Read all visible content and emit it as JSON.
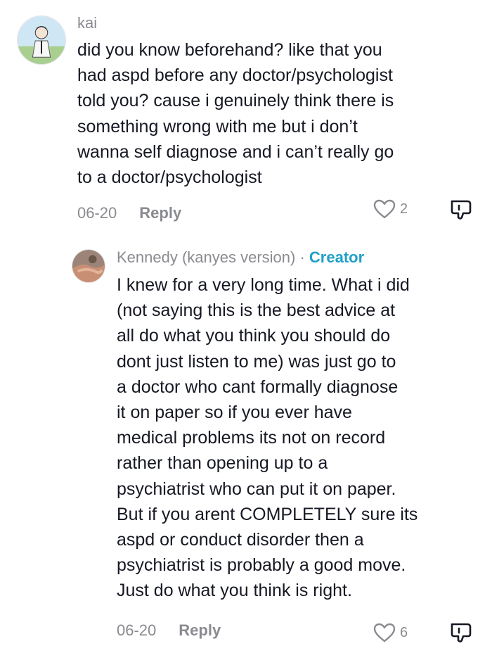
{
  "comments": [
    {
      "avatar_icon": "user-avatar-icon",
      "username": "kai",
      "text_lines": [
        "did you know beforehand? like that you",
        "had aspd before any doctor/psychologist",
        "told you? cause i genuinely think there is",
        "something wrong with me but i don’t",
        "wanna self diagnose and i can’t really go",
        "to a doctor/psychologist"
      ],
      "date": "06-20",
      "reply_label": "Reply",
      "like_count": "2",
      "like_icon": "heart-outline-icon",
      "dislike_icon": "thumbs-down-icon"
    },
    {
      "avatar_icon": "user-avatar-icon",
      "username": "Kennedy (kanyes version)",
      "separator": " · ",
      "badge": "Creator",
      "text_lines": [
        "I knew for a very long time. What i did",
        "(not saying this is the best advice at",
        "all do what you think you should do",
        "dont just listen to me) was just go to",
        "a doctor who cant formally diagnose",
        "it on paper so if you ever have",
        "medical problems its not on record",
        "rather than opening up to a",
        "psychiatrist who can put it on paper.",
        "But if you arent COMPLETELY sure its",
        "aspd or conduct disorder then a",
        "psychiatrist is probably a good move.",
        "Just do what you think is right."
      ],
      "date": "06-20",
      "reply_label": "Reply",
      "like_count": "6",
      "like_icon": "heart-outline-icon",
      "dislike_icon": "thumbs-down-icon"
    }
  ],
  "colors": {
    "text": "#161823",
    "muted": "#8a8b91",
    "creator": "#20a0c8"
  }
}
